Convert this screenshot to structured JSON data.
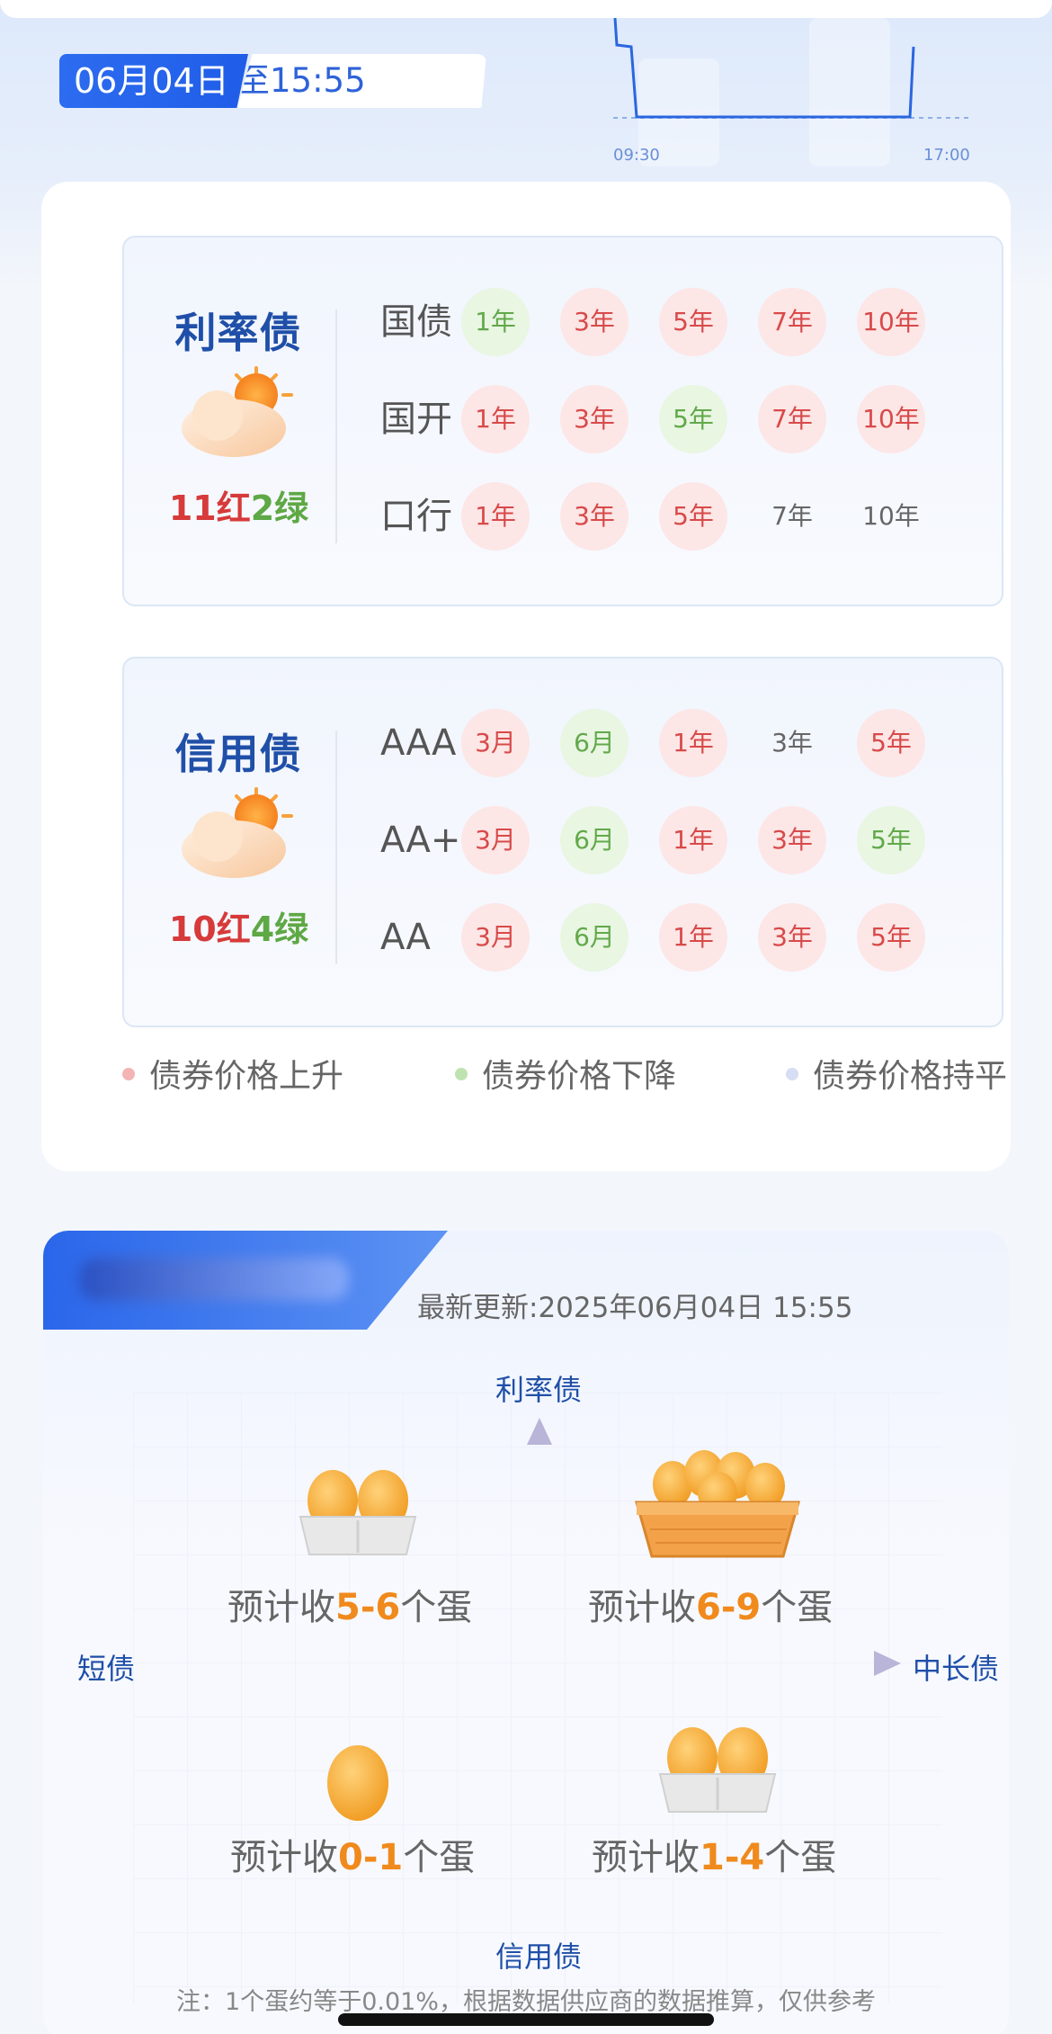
{
  "header": {
    "date": "06月04日",
    "as_of": "截至15:55",
    "chart_start": "09:30",
    "chart_end": "17:00"
  },
  "rate_bonds": {
    "title": "利率债",
    "red_count": "11红",
    "green_count": "2绿",
    "weather": "sunny-cloud-icon",
    "rows": [
      {
        "label": "国债",
        "items": [
          {
            "text": "1年",
            "status": "green"
          },
          {
            "text": "3年",
            "status": "red"
          },
          {
            "text": "5年",
            "status": "red"
          },
          {
            "text": "7年",
            "status": "red"
          },
          {
            "text": "10年",
            "status": "red"
          }
        ]
      },
      {
        "label": "国开",
        "items": [
          {
            "text": "1年",
            "status": "red"
          },
          {
            "text": "3年",
            "status": "red"
          },
          {
            "text": "5年",
            "status": "green"
          },
          {
            "text": "7年",
            "status": "red"
          },
          {
            "text": "10年",
            "status": "red"
          }
        ]
      },
      {
        "label": "口行",
        "items": [
          {
            "text": "1年",
            "status": "red"
          },
          {
            "text": "3年",
            "status": "red"
          },
          {
            "text": "5年",
            "status": "red"
          },
          {
            "text": "7年",
            "status": "flat"
          },
          {
            "text": "10年",
            "status": "flat"
          }
        ]
      }
    ]
  },
  "credit_bonds": {
    "title": "信用债",
    "red_count": "10红",
    "green_count": "4绿",
    "weather": "sunny-cloud-icon",
    "rows": [
      {
        "label": "AAA",
        "items": [
          {
            "text": "3月",
            "status": "red"
          },
          {
            "text": "6月",
            "status": "green"
          },
          {
            "text": "1年",
            "status": "red"
          },
          {
            "text": "3年",
            "status": "flat"
          },
          {
            "text": "5年",
            "status": "red"
          }
        ]
      },
      {
        "label": "AA+",
        "items": [
          {
            "text": "3月",
            "status": "red"
          },
          {
            "text": "6月",
            "status": "green"
          },
          {
            "text": "1年",
            "status": "red"
          },
          {
            "text": "3年",
            "status": "red"
          },
          {
            "text": "5年",
            "status": "green"
          }
        ]
      },
      {
        "label": "AA",
        "items": [
          {
            "text": "3月",
            "status": "red"
          },
          {
            "text": "6月",
            "status": "green"
          },
          {
            "text": "1年",
            "status": "red"
          },
          {
            "text": "3年",
            "status": "red"
          },
          {
            "text": "5年",
            "status": "red"
          }
        ]
      }
    ]
  },
  "legend": [
    {
      "label": "债券价格上升",
      "color": "#f4b4b4"
    },
    {
      "label": "债券价格下降",
      "color": "#bfe3b0"
    },
    {
      "label": "债券价格持平",
      "color": "#d6def3"
    }
  ],
  "quadrant": {
    "update_text": "最新更新:2025年06月04日 15:55",
    "axis_top": "利率债",
    "axis_bottom": "信用债",
    "axis_left": "短债",
    "axis_right": "中长债",
    "q_top_left": {
      "prefix": "预计收",
      "value": "5-6",
      "suffix": "个蛋",
      "icon": "egg-carton-icon"
    },
    "q_top_right": {
      "prefix": "预计收",
      "value": "6-9",
      "suffix": "个蛋",
      "icon": "egg-basket-icon"
    },
    "q_bottom_left": {
      "prefix": "预计收",
      "value": "0-1",
      "suffix": "个蛋",
      "icon": "single-egg-icon"
    },
    "q_bottom_right": {
      "prefix": "预计收",
      "value": "1-4",
      "suffix": "个蛋",
      "icon": "egg-carton-icon"
    },
    "note": "注：1个蛋约等于0.01%，根据数据供应商的数据推算，仅供参考"
  },
  "colors": {
    "accent_blue": "#2d6cf0",
    "up_red": "#d84a4a",
    "down_green": "#62a94a",
    "egg_orange": "#f08a1c"
  }
}
